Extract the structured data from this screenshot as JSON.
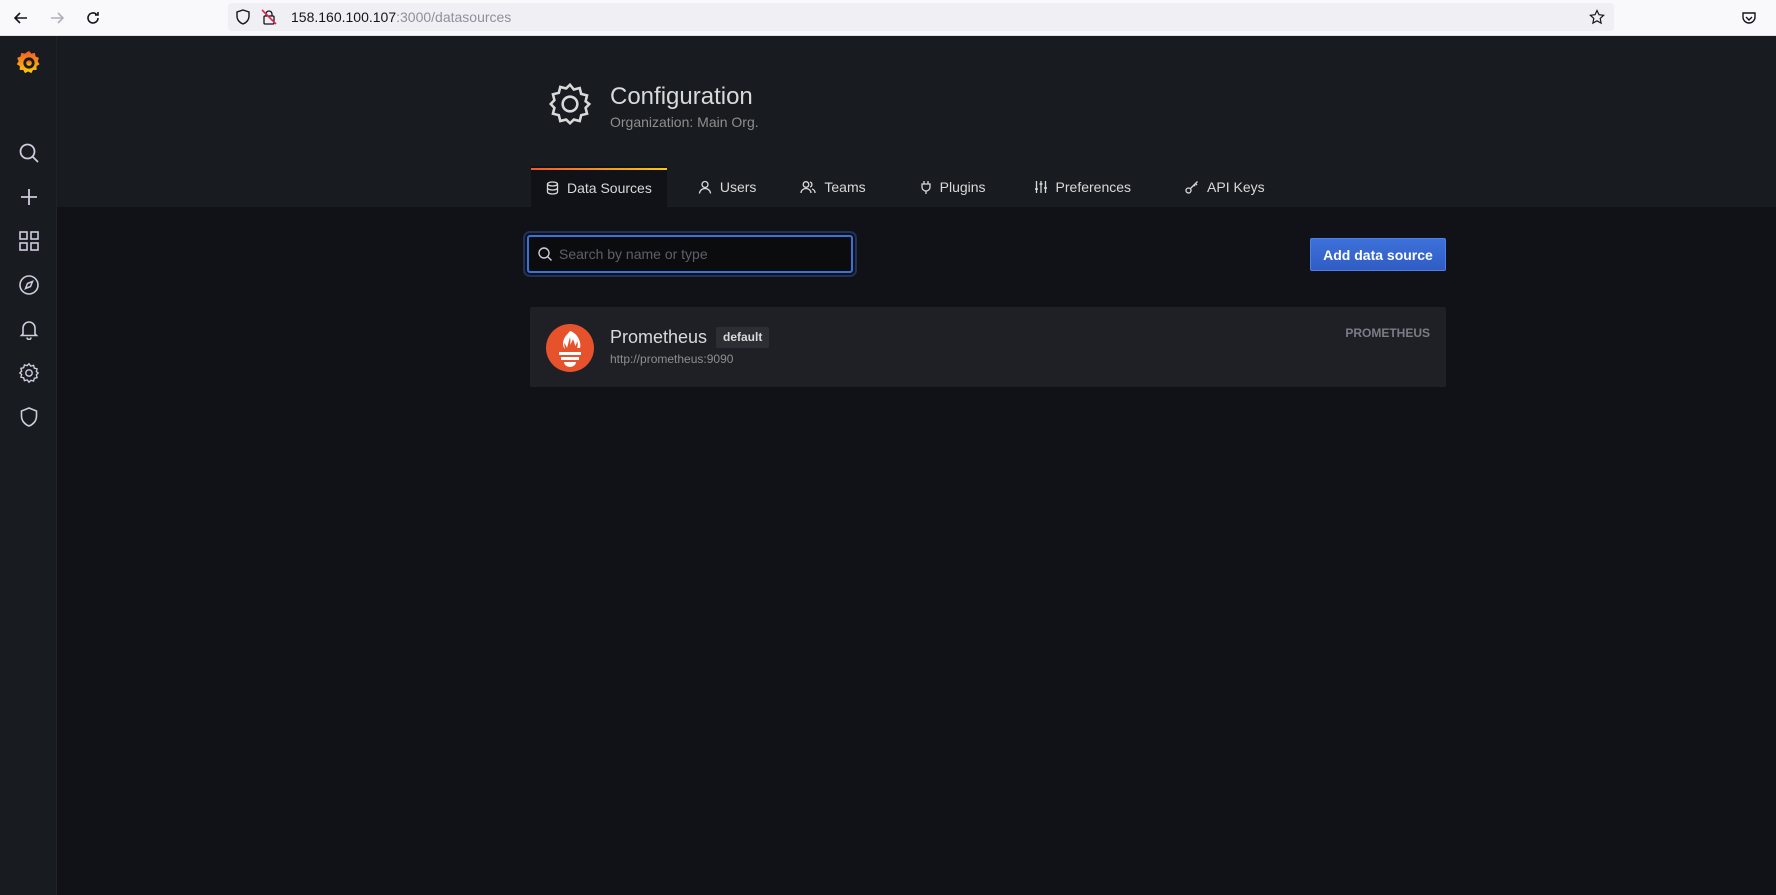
{
  "browser": {
    "url_host": "158.160.100.107",
    "url_path": ":3000/datasources"
  },
  "sidebar": {
    "items": [
      {
        "icon": "grafana-logo-icon"
      },
      {
        "icon": "search-icon"
      },
      {
        "icon": "plus-icon"
      },
      {
        "icon": "dashboards-icon"
      },
      {
        "icon": "explore-icon"
      },
      {
        "icon": "alerting-bell-icon"
      },
      {
        "icon": "gear-icon"
      },
      {
        "icon": "shield-icon"
      }
    ]
  },
  "header": {
    "title": "Configuration",
    "subtitle": "Organization: Main Org.",
    "tabs": [
      {
        "label": "Data Sources",
        "icon": "database-icon",
        "active": true
      },
      {
        "label": "Users",
        "icon": "user-icon"
      },
      {
        "label": "Teams",
        "icon": "users-icon"
      },
      {
        "label": "Plugins",
        "icon": "plug-icon"
      },
      {
        "label": "Preferences",
        "icon": "sliders-icon"
      },
      {
        "label": "API Keys",
        "icon": "key-icon"
      }
    ]
  },
  "main": {
    "search_placeholder": "Search by name or type",
    "add_button_label": "Add data source",
    "datasources": [
      {
        "name": "Prometheus",
        "badge": "default",
        "url": "http://prometheus:9090",
        "type": "PROMETHEUS"
      }
    ]
  },
  "colors": {
    "accent": "#3d71d9",
    "background": "#111217",
    "panel": "#181b1f",
    "prometheus": "#e6522c"
  }
}
